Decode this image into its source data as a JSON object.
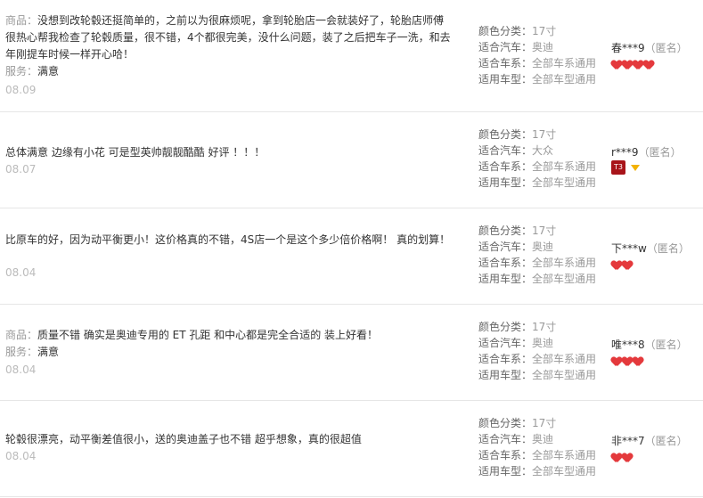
{
  "labels": {
    "color": "颜色分类：",
    "car": "适合汽车：",
    "series": "适合车系：",
    "model": "适用车型："
  },
  "reviews": [
    {
      "comment_prefix": "商品：",
      "comment": "没想到改轮毂还挺简单的，之前以为很麻烦呢，拿到轮胎店一会就装好了，轮胎店师傅很热心帮我检查了轮毂质量，很不错，4个都很完美，没什么问题，装了之后把车子一洗，和去年刚提车时候一样开心哈！",
      "service_prefix": "服务：",
      "service": "满意",
      "date": "08.09",
      "color": "17寸",
      "car": "奥迪",
      "series": "全部车系通用",
      "model": "全部车型通用",
      "nick": "春***9",
      "anon": "（匿名）",
      "badge": "hearts-4"
    },
    {
      "comment": "总体满意 边缘有小花 可是型英帅靓靓酷酷 好评 ！！！",
      "date": "08.07",
      "color": "17寸",
      "car": "大众",
      "series": "全部车系通用",
      "model": "全部车型通用",
      "nick": "r***9",
      "anon": "（匿名）",
      "badge_text": "T3",
      "badge": "t3-and-gem"
    },
    {
      "comment": "比原车的好，因为动平衡更小！这价格真的不错，4S店一个是这个多少倍价格啊！ 真的划算！",
      "date": "08.04",
      "color": "17寸",
      "car": "奥迪",
      "series": "全部车系通用",
      "model": "全部车型通用",
      "nick": "下***w",
      "anon": "（匿名）",
      "badge": "hearts-2"
    },
    {
      "comment_prefix": "商品：",
      "comment": "质量不错 确实是奥迪专用的 ET 孔距 和中心都是完全合适的 装上好看！",
      "service_prefix": "服务：",
      "service": "满意",
      "date": "08.04",
      "color": "17寸",
      "car": "奥迪",
      "series": "全部车系通用",
      "model": "全部车型通用",
      "nick": "唯***8",
      "anon": "（匿名）",
      "badge": "hearts-3"
    },
    {
      "comment": "轮毂很漂亮，动平衡差值很小，送的奥迪盖子也不错 超乎想象，真的很超值",
      "date": "08.04",
      "color": "17寸",
      "car": "奥迪",
      "series": "全部车系通用",
      "model": "全部车型通用",
      "nick": "非***7",
      "anon": "（匿名）",
      "badge": "hearts-2"
    }
  ]
}
